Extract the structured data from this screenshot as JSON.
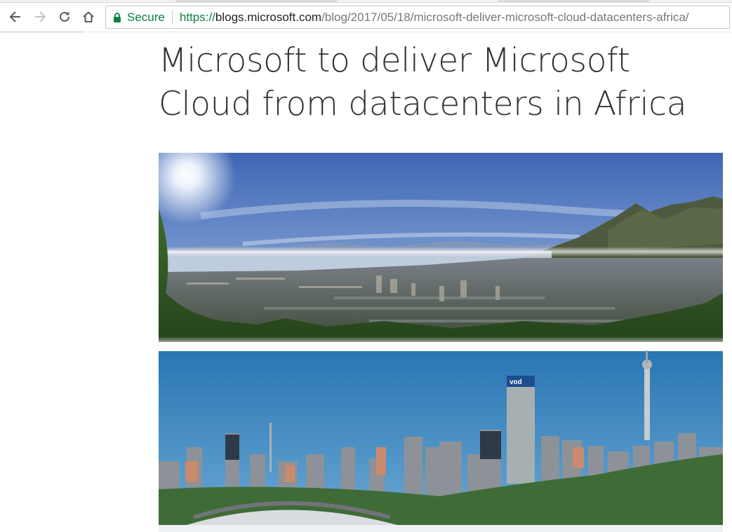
{
  "browser": {
    "security_label": "Secure",
    "url": {
      "scheme": "https://",
      "host": "blogs.microsoft.com",
      "path": "/blog/2017/05/18/microsoft-deliver-microsoft-cloud-datacenters-africa/"
    },
    "icons": {
      "back": "arrow-left-icon",
      "forward": "arrow-right-icon",
      "reload": "reload-icon",
      "home": "home-icon",
      "lock": "lock-icon"
    },
    "colors": {
      "secure_green": "#0b8043",
      "host_text": "#222222",
      "path_text": "#777777"
    }
  },
  "article": {
    "title": "Microsoft to deliver Microsoft Cloud from datacenters in Africa",
    "hero_image": {
      "building_sign": "vod"
    }
  }
}
